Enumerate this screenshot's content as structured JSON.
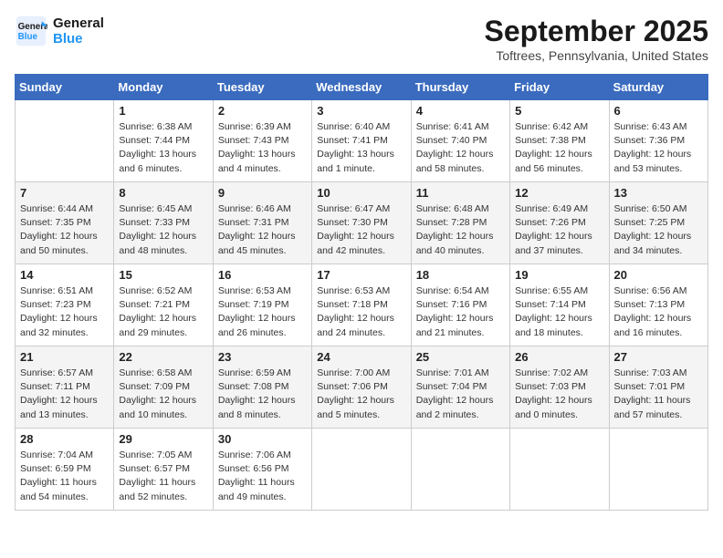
{
  "header": {
    "logo_line1": "General",
    "logo_line2": "Blue",
    "month": "September 2025",
    "location": "Toftrees, Pennsylvania, United States"
  },
  "weekdays": [
    "Sunday",
    "Monday",
    "Tuesday",
    "Wednesday",
    "Thursday",
    "Friday",
    "Saturday"
  ],
  "weeks": [
    [
      {
        "day": "",
        "info": ""
      },
      {
        "day": "1",
        "info": "Sunrise: 6:38 AM\nSunset: 7:44 PM\nDaylight: 13 hours\nand 6 minutes."
      },
      {
        "day": "2",
        "info": "Sunrise: 6:39 AM\nSunset: 7:43 PM\nDaylight: 13 hours\nand 4 minutes."
      },
      {
        "day": "3",
        "info": "Sunrise: 6:40 AM\nSunset: 7:41 PM\nDaylight: 13 hours\nand 1 minute."
      },
      {
        "day": "4",
        "info": "Sunrise: 6:41 AM\nSunset: 7:40 PM\nDaylight: 12 hours\nand 58 minutes."
      },
      {
        "day": "5",
        "info": "Sunrise: 6:42 AM\nSunset: 7:38 PM\nDaylight: 12 hours\nand 56 minutes."
      },
      {
        "day": "6",
        "info": "Sunrise: 6:43 AM\nSunset: 7:36 PM\nDaylight: 12 hours\nand 53 minutes."
      }
    ],
    [
      {
        "day": "7",
        "info": "Sunrise: 6:44 AM\nSunset: 7:35 PM\nDaylight: 12 hours\nand 50 minutes."
      },
      {
        "day": "8",
        "info": "Sunrise: 6:45 AM\nSunset: 7:33 PM\nDaylight: 12 hours\nand 48 minutes."
      },
      {
        "day": "9",
        "info": "Sunrise: 6:46 AM\nSunset: 7:31 PM\nDaylight: 12 hours\nand 45 minutes."
      },
      {
        "day": "10",
        "info": "Sunrise: 6:47 AM\nSunset: 7:30 PM\nDaylight: 12 hours\nand 42 minutes."
      },
      {
        "day": "11",
        "info": "Sunrise: 6:48 AM\nSunset: 7:28 PM\nDaylight: 12 hours\nand 40 minutes."
      },
      {
        "day": "12",
        "info": "Sunrise: 6:49 AM\nSunset: 7:26 PM\nDaylight: 12 hours\nand 37 minutes."
      },
      {
        "day": "13",
        "info": "Sunrise: 6:50 AM\nSunset: 7:25 PM\nDaylight: 12 hours\nand 34 minutes."
      }
    ],
    [
      {
        "day": "14",
        "info": "Sunrise: 6:51 AM\nSunset: 7:23 PM\nDaylight: 12 hours\nand 32 minutes."
      },
      {
        "day": "15",
        "info": "Sunrise: 6:52 AM\nSunset: 7:21 PM\nDaylight: 12 hours\nand 29 minutes."
      },
      {
        "day": "16",
        "info": "Sunrise: 6:53 AM\nSunset: 7:19 PM\nDaylight: 12 hours\nand 26 minutes."
      },
      {
        "day": "17",
        "info": "Sunrise: 6:53 AM\nSunset: 7:18 PM\nDaylight: 12 hours\nand 24 minutes."
      },
      {
        "day": "18",
        "info": "Sunrise: 6:54 AM\nSunset: 7:16 PM\nDaylight: 12 hours\nand 21 minutes."
      },
      {
        "day": "19",
        "info": "Sunrise: 6:55 AM\nSunset: 7:14 PM\nDaylight: 12 hours\nand 18 minutes."
      },
      {
        "day": "20",
        "info": "Sunrise: 6:56 AM\nSunset: 7:13 PM\nDaylight: 12 hours\nand 16 minutes."
      }
    ],
    [
      {
        "day": "21",
        "info": "Sunrise: 6:57 AM\nSunset: 7:11 PM\nDaylight: 12 hours\nand 13 minutes."
      },
      {
        "day": "22",
        "info": "Sunrise: 6:58 AM\nSunset: 7:09 PM\nDaylight: 12 hours\nand 10 minutes."
      },
      {
        "day": "23",
        "info": "Sunrise: 6:59 AM\nSunset: 7:08 PM\nDaylight: 12 hours\nand 8 minutes."
      },
      {
        "day": "24",
        "info": "Sunrise: 7:00 AM\nSunset: 7:06 PM\nDaylight: 12 hours\nand 5 minutes."
      },
      {
        "day": "25",
        "info": "Sunrise: 7:01 AM\nSunset: 7:04 PM\nDaylight: 12 hours\nand 2 minutes."
      },
      {
        "day": "26",
        "info": "Sunrise: 7:02 AM\nSunset: 7:03 PM\nDaylight: 12 hours\nand 0 minutes."
      },
      {
        "day": "27",
        "info": "Sunrise: 7:03 AM\nSunset: 7:01 PM\nDaylight: 11 hours\nand 57 minutes."
      }
    ],
    [
      {
        "day": "28",
        "info": "Sunrise: 7:04 AM\nSunset: 6:59 PM\nDaylight: 11 hours\nand 54 minutes."
      },
      {
        "day": "29",
        "info": "Sunrise: 7:05 AM\nSunset: 6:57 PM\nDaylight: 11 hours\nand 52 minutes."
      },
      {
        "day": "30",
        "info": "Sunrise: 7:06 AM\nSunset: 6:56 PM\nDaylight: 11 hours\nand 49 minutes."
      },
      {
        "day": "",
        "info": ""
      },
      {
        "day": "",
        "info": ""
      },
      {
        "day": "",
        "info": ""
      },
      {
        "day": "",
        "info": ""
      }
    ]
  ]
}
